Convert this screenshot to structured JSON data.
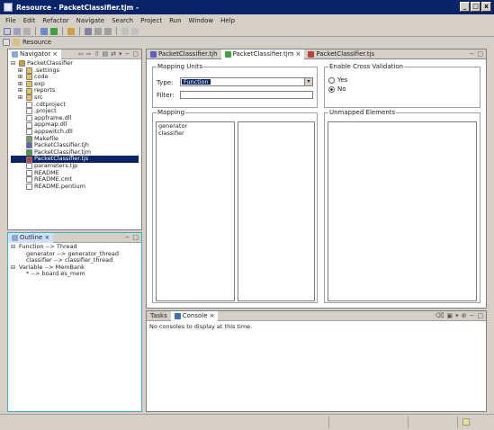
{
  "window": {
    "title": "Resource - PacketClassifier.tjm -",
    "minimize": "_",
    "maximize": "□",
    "close": "x"
  },
  "menu": [
    "File",
    "Edit",
    "Refactor",
    "Navigate",
    "Search",
    "Project",
    "Run",
    "Window",
    "Help"
  ],
  "perspective": {
    "label": "Resource"
  },
  "navigator": {
    "tab_label": "Navigator",
    "items": [
      {
        "label": "PacketClassifier",
        "indent": 0,
        "expander": "⊟",
        "kind": "project"
      },
      {
        "label": ".settings",
        "indent": 1,
        "expander": "⊞",
        "kind": "folder"
      },
      {
        "label": "code",
        "indent": 1,
        "expander": "⊞",
        "kind": "folder"
      },
      {
        "label": "exp",
        "indent": 1,
        "expander": "⊞",
        "kind": "folder"
      },
      {
        "label": "reports",
        "indent": 1,
        "expander": "⊞",
        "kind": "folder"
      },
      {
        "label": "src",
        "indent": 1,
        "expander": "⊞",
        "kind": "folder"
      },
      {
        "label": ".cdtproject",
        "indent": 1,
        "expander": "",
        "kind": "file"
      },
      {
        "label": ".project",
        "indent": 1,
        "expander": "",
        "kind": "file"
      },
      {
        "label": "appframe.dll",
        "indent": 1,
        "expander": "",
        "kind": "file"
      },
      {
        "label": "appmap.dll",
        "indent": 1,
        "expander": "",
        "kind": "file"
      },
      {
        "label": "appswitch.dll",
        "indent": 1,
        "expander": "",
        "kind": "file"
      },
      {
        "label": "Makefile",
        "indent": 1,
        "expander": "",
        "kind": "make"
      },
      {
        "label": "PacketClassifier.tjh",
        "indent": 1,
        "expander": "",
        "kind": "tjh"
      },
      {
        "label": "PacketClassifier.tjm",
        "indent": 1,
        "expander": "",
        "kind": "tjm"
      },
      {
        "label": "PacketClassifier.tjs",
        "indent": 1,
        "expander": "",
        "kind": "tjs",
        "selected": true
      },
      {
        "label": "parameters.tjp",
        "indent": 1,
        "expander": "",
        "kind": "file"
      },
      {
        "label": "README",
        "indent": 1,
        "expander": "",
        "kind": "file"
      },
      {
        "label": "README.cmt",
        "indent": 1,
        "expander": "",
        "kind": "file"
      },
      {
        "label": "README.pentium",
        "indent": 1,
        "expander": "",
        "kind": "file"
      }
    ]
  },
  "outline": {
    "tab_label": "Outline",
    "items": [
      {
        "label": "Function --> Thread",
        "indent": 0,
        "expander": "⊟"
      },
      {
        "label": "generator --> generator_thread",
        "indent": 1,
        "expander": ""
      },
      {
        "label": "classifier --> classifier_thread",
        "indent": 1,
        "expander": ""
      },
      {
        "label": "Variable --> MemBank",
        "indent": 0,
        "expander": "⊟"
      },
      {
        "label": "* --> board.es_mem",
        "indent": 1,
        "expander": ""
      }
    ]
  },
  "editor": {
    "tabs": [
      {
        "label": "PacketClassifier.tjh",
        "active": false
      },
      {
        "label": "PacketClassifier.tjm",
        "active": true
      },
      {
        "label": "PacketClassifier.tjs",
        "active": false
      }
    ],
    "mapping_units": {
      "label": "Mapping Units",
      "type_label": "Type:",
      "type_value": "Function",
      "filter_label": "Filter:",
      "filter_value": ""
    },
    "cross_validation": {
      "label": "Enable Cross Validation",
      "options": [
        {
          "label": "Yes",
          "checked": false
        },
        {
          "label": "No",
          "checked": true
        }
      ]
    },
    "mapping": {
      "label": "Mapping",
      "items": [
        "generator",
        "classifier"
      ]
    },
    "unmapped": {
      "label": "Unmapped Elements"
    }
  },
  "console": {
    "tabs": [
      {
        "label": "Tasks",
        "active": false
      },
      {
        "label": "Console",
        "active": true
      }
    ],
    "message": "No consoles to display at this time."
  }
}
